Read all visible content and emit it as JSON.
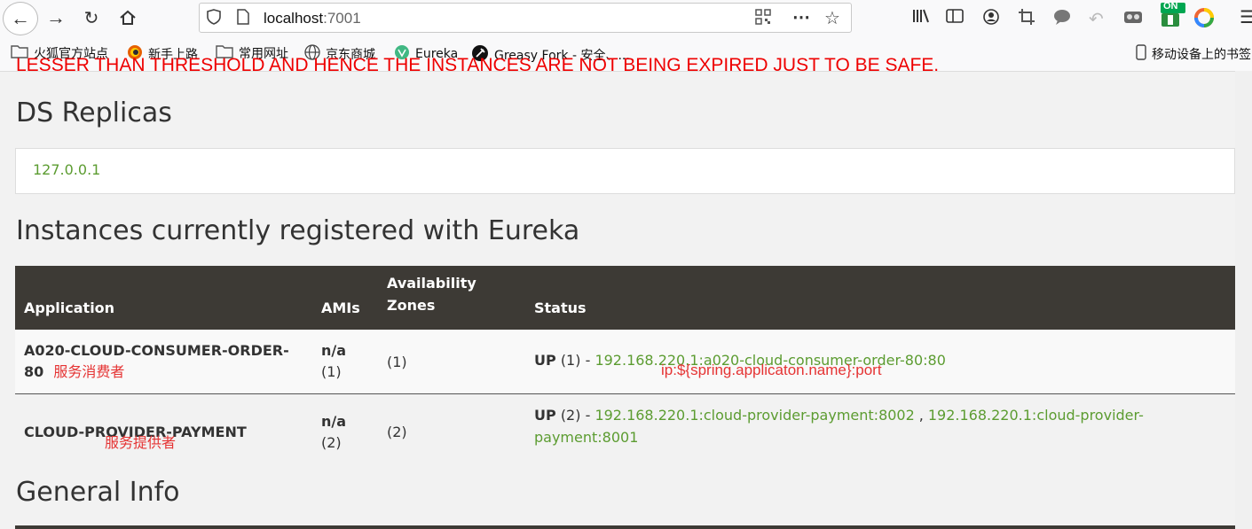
{
  "browser": {
    "url_host": "localhost",
    "url_port": ":7001",
    "extension_badge": "ON",
    "bookmarks": [
      "火狐官方站点",
      "新手上路",
      "常用网址",
      "京东商城",
      "Eureka",
      "Greasy Fork - 安全、...",
      "移动设备上的书签"
    ]
  },
  "page": {
    "warning": "LESSER THAN THRESHOLD AND HENCE THE INSTANCES ARE NOT BEING EXPIRED JUST TO BE SAFE.",
    "ds_title": "DS Replicas",
    "replica": "127.0.0.1",
    "instances_title": "Instances currently registered with Eureka",
    "general_title": "General Info"
  },
  "table": {
    "headers": [
      "Application",
      "AMIs",
      "Availability Zones",
      "Status"
    ],
    "rows": [
      {
        "app": "A020-CLOUD-CONSUMER-ORDER-80",
        "note": "服务消费者",
        "ami": "n/a",
        "ami_count": "(1)",
        "zones": "(1)",
        "status_state": "UP",
        "status_count": "(1) -",
        "links": [
          "192.168.220.1:a020-cloud-consumer-order-80:80"
        ],
        "annotation": "ip:${spring.applicaton.name}:port"
      },
      {
        "app": "CLOUD-PROVIDER-PAYMENT",
        "note": "服务提供者",
        "ami": "n/a",
        "ami_count": "(2)",
        "zones": "(2)",
        "status_state": "UP",
        "status_count": "(2) -",
        "links": [
          "192.168.220.1:cloud-provider-payment:8002",
          "192.168.220.1:cloud-provider-payment:8001"
        ],
        "separator": ","
      }
    ]
  }
}
